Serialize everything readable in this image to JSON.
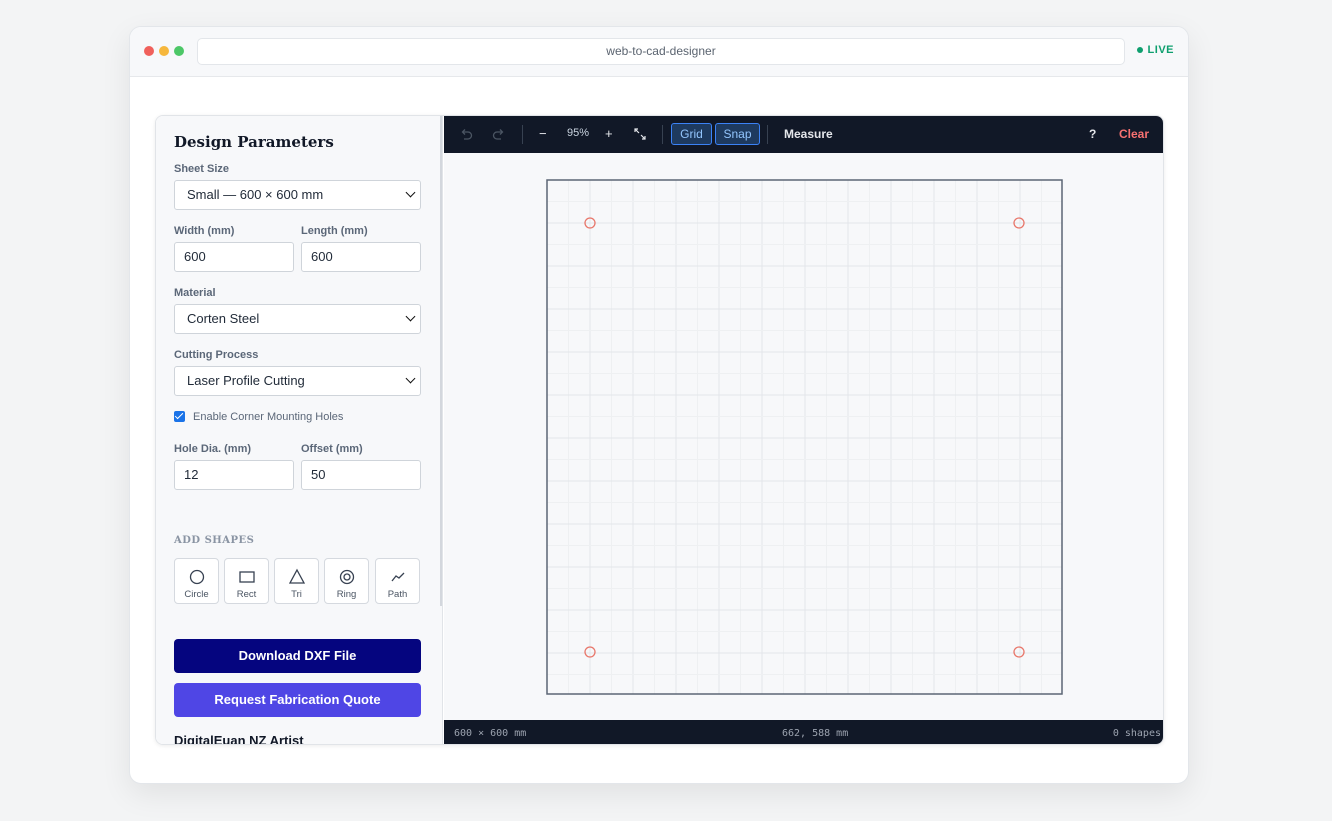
{
  "browser": {
    "url": "web-to-cad-designer",
    "status": "LIVE"
  },
  "sidebar": {
    "title": "Design Parameters",
    "sheet_size": {
      "label": "Sheet Size",
      "value": "Small — 600 × 600 mm"
    },
    "width": {
      "label": "Width (mm)",
      "value": "600"
    },
    "length": {
      "label": "Length (mm)",
      "value": "600"
    },
    "material": {
      "label": "Material",
      "value": "Corten Steel"
    },
    "process": {
      "label": "Cutting Process",
      "value": "Laser Profile Cutting"
    },
    "corner_holes": {
      "label": "Enable Corner Mounting Holes",
      "checked": true
    },
    "hole_dia": {
      "label": "Hole Dia. (mm)",
      "value": "12"
    },
    "offset": {
      "label": "Offset (mm)",
      "value": "50"
    },
    "add_shapes": {
      "heading": "ADD SHAPES",
      "items": [
        {
          "label": "Circle",
          "icon": "circle-icon"
        },
        {
          "label": "Rect",
          "icon": "rect-icon"
        },
        {
          "label": "Tri",
          "icon": "triangle-icon"
        },
        {
          "label": "Ring",
          "icon": "ring-icon"
        },
        {
          "label": "Path",
          "icon": "path-icon"
        }
      ]
    },
    "download_label": "Download DXF File",
    "quote_label": "Request Fabrication Quote",
    "brand": "DigitalEuan NZ Artist"
  },
  "toolbar": {
    "undo_icon": "undo-icon",
    "redo_icon": "redo-icon",
    "zoom_out": "−",
    "zoom": "95%",
    "zoom_in": "+",
    "fit_icon": "fit-icon",
    "grid": "Grid",
    "snap": "Snap",
    "measure": "Measure",
    "help": "?",
    "clear": "Clear"
  },
  "canvas": {
    "hole_color": "#e8776b",
    "sheet_border": "#5c6675"
  },
  "status": {
    "size": "600 × 600 mm",
    "cursor": "662, 588 mm",
    "shapes": "0 shapes"
  }
}
